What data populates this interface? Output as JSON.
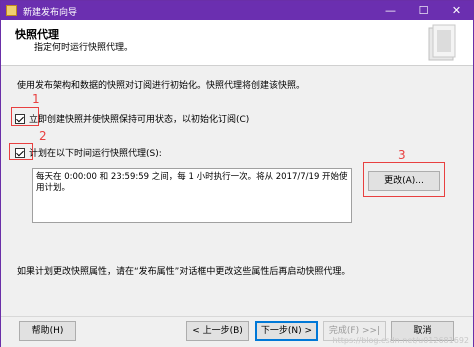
{
  "window": {
    "title": "新建发布向导",
    "minimize": "—",
    "maximize": "☐",
    "close": "✕"
  },
  "header": {
    "title": "快照代理",
    "subtitle": "指定何时运行快照代理。"
  },
  "intro": "使用发布架构和数据的快照对订阅进行初始化。快照代理将创建该快照。",
  "option1": {
    "label": "立即创建快照并使快照保持可用状态，以初始化订阅(C)",
    "checked": true
  },
  "option2": {
    "label": "计划在以下时间运行快照代理(S):",
    "checked": true
  },
  "schedule_text": "每天在 0:00:00 和 23:59:59 之间，每 1 小时执行一次。将从 2017/7/19 开始使用计划。",
  "change_button": "更改(A)...",
  "note": "如果计划更改快照属性，请在“发布属性”对话框中更改这些属性后再启动快照代理。",
  "annotations": {
    "n1": "1",
    "n2": "2",
    "n3": "3"
  },
  "footer": {
    "help": "帮助(H)",
    "back": "< 上一步(B)",
    "next": "下一步(N) >",
    "finish": "完成(F) >>|",
    "cancel": "取消"
  },
  "watermark": "https://blog.csdn.net/u012681692"
}
